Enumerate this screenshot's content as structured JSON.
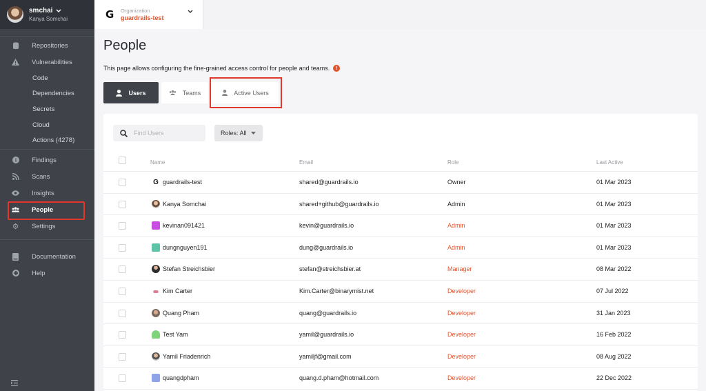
{
  "user": {
    "username": "smchai",
    "fullname": "Kanya Somchai"
  },
  "nav": {
    "repositories": "Repositories",
    "vulnerabilities": "Vulnerabilities",
    "sub": [
      "Code",
      "Dependencies",
      "Secrets",
      "Cloud",
      "Actions (4278)"
    ],
    "findings": "Findings",
    "scans": "Scans",
    "insights": "Insights",
    "people": "People",
    "settings": "Settings",
    "documentation": "Documentation",
    "help": "Help"
  },
  "org": {
    "label": "Organization",
    "name": "guardrails-test"
  },
  "page": {
    "title": "People",
    "description": "This page allows configuring the fine-grained access control for people and teams."
  },
  "tabs": {
    "users": "Users",
    "teams": "Teams",
    "active_users": "Active Users"
  },
  "filters": {
    "search_placeholder": "Find Users",
    "roles": "Roles: All"
  },
  "table": {
    "headers": {
      "name": "Name",
      "email": "Email",
      "role": "Role",
      "last_active": "Last Active"
    },
    "rows": [
      {
        "name": "guardrails-test",
        "email": "shared@guardrails.io",
        "role": "Owner",
        "last_active": "01 Mar 2023"
      },
      {
        "name": "Kanya Somchai",
        "email": "shared+github@guardrails.io",
        "role": "Admin",
        "last_active": "01 Mar 2023"
      },
      {
        "name": "kevinan091421",
        "email": "kevin@guardrails.io",
        "role": "Admin",
        "last_active": "01 Mar 2023"
      },
      {
        "name": "dungnguyen191",
        "email": "dung@guardrails.io",
        "role": "Admin",
        "last_active": "01 Mar 2023"
      },
      {
        "name": "Stefan Streichsbier",
        "email": "stefan@streichsbier.at",
        "role": "Manager",
        "last_active": "08 Mar 2022"
      },
      {
        "name": "Kim Carter",
        "email": "Kim.Carter@binarymist.net",
        "role": "Developer",
        "last_active": "07 Jul 2022"
      },
      {
        "name": "Quang Pham",
        "email": "quang@guardrails.io",
        "role": "Developer",
        "last_active": "31 Jan 2023"
      },
      {
        "name": "Test Yam",
        "email": "yamil@guardrails.io",
        "role": "Developer",
        "last_active": "16 Feb 2022"
      },
      {
        "name": "Yamil Friadenrich",
        "email": "yamiljf@gmail.com",
        "role": "Developer",
        "last_active": "08 Aug 2022"
      },
      {
        "name": "quangdpham",
        "email": "quang.d.pham@hotmail.com",
        "role": "Developer",
        "last_active": "22 Dec 2022"
      }
    ]
  },
  "colors": {
    "sidebar": "#3f4249",
    "accent": "#e0532c",
    "highlight": "#e0382c"
  }
}
